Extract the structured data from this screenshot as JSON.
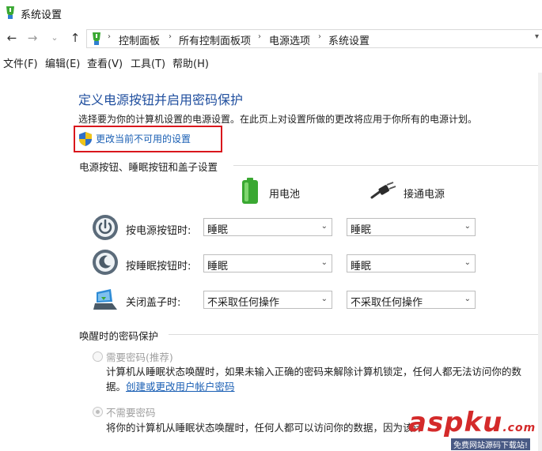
{
  "window": {
    "title": "系统设置"
  },
  "nav": {
    "back": "←",
    "forward": "→",
    "recent": "⌄",
    "up": "↑"
  },
  "breadcrumb": {
    "items": [
      "控制面板",
      "所有控制面板项",
      "电源选项",
      "系统设置"
    ],
    "separator": "›"
  },
  "menubar": {
    "items": [
      "文件(F)",
      "编辑(E)",
      "查看(V)",
      "工具(T)",
      "帮助(H)"
    ]
  },
  "page": {
    "heading": "定义电源按钮并启用密码保护",
    "description": "选择要为你的计算机设置的电源设置。在此页上对设置所做的更改将应用于你所有的电源计划。",
    "change_link": "更改当前不可用的设置"
  },
  "buttons_section": {
    "title": "电源按钮、睡眠按钮和盖子设置",
    "col_battery": "用电池",
    "col_plugged": "接通电源",
    "rows": [
      {
        "label": "按电源按钮时:",
        "battery": "睡眠",
        "plugged": "睡眠",
        "icon": "power-button-icon"
      },
      {
        "label": "按睡眠按钮时:",
        "battery": "睡眠",
        "plugged": "睡眠",
        "icon": "sleep-button-icon"
      },
      {
        "label": "关闭盖子时:",
        "battery": "不采取任何操作",
        "plugged": "不采取任何操作",
        "icon": "laptop-lid-icon"
      }
    ]
  },
  "password_section": {
    "title": "唤醒时的密码保护",
    "option1_label": "需要密码(推荐)",
    "option1_desc_line1": "计算机从睡眠状态唤醒时，如果未输入正确的密码来解除计算机锁定，任何人都无法访问你的数",
    "option1_desc_line2_prefix": "据。",
    "option1_link": "创建或更改用户帐户密码",
    "option2_label": "不需要密码",
    "option2_desc": "将你的计算机从睡眠状态唤醒时，任何人都可以访问你的数据，因为该计",
    "selected": "不需要密码"
  },
  "watermark": {
    "logo": "aspku",
    "domain": ".com",
    "sub": "免费网站源码下载站!"
  },
  "colors": {
    "heading": "#1f4e9e",
    "link": "#1a5fb4",
    "highlight": "#d9161c",
    "battery_green": "#3aa832"
  }
}
